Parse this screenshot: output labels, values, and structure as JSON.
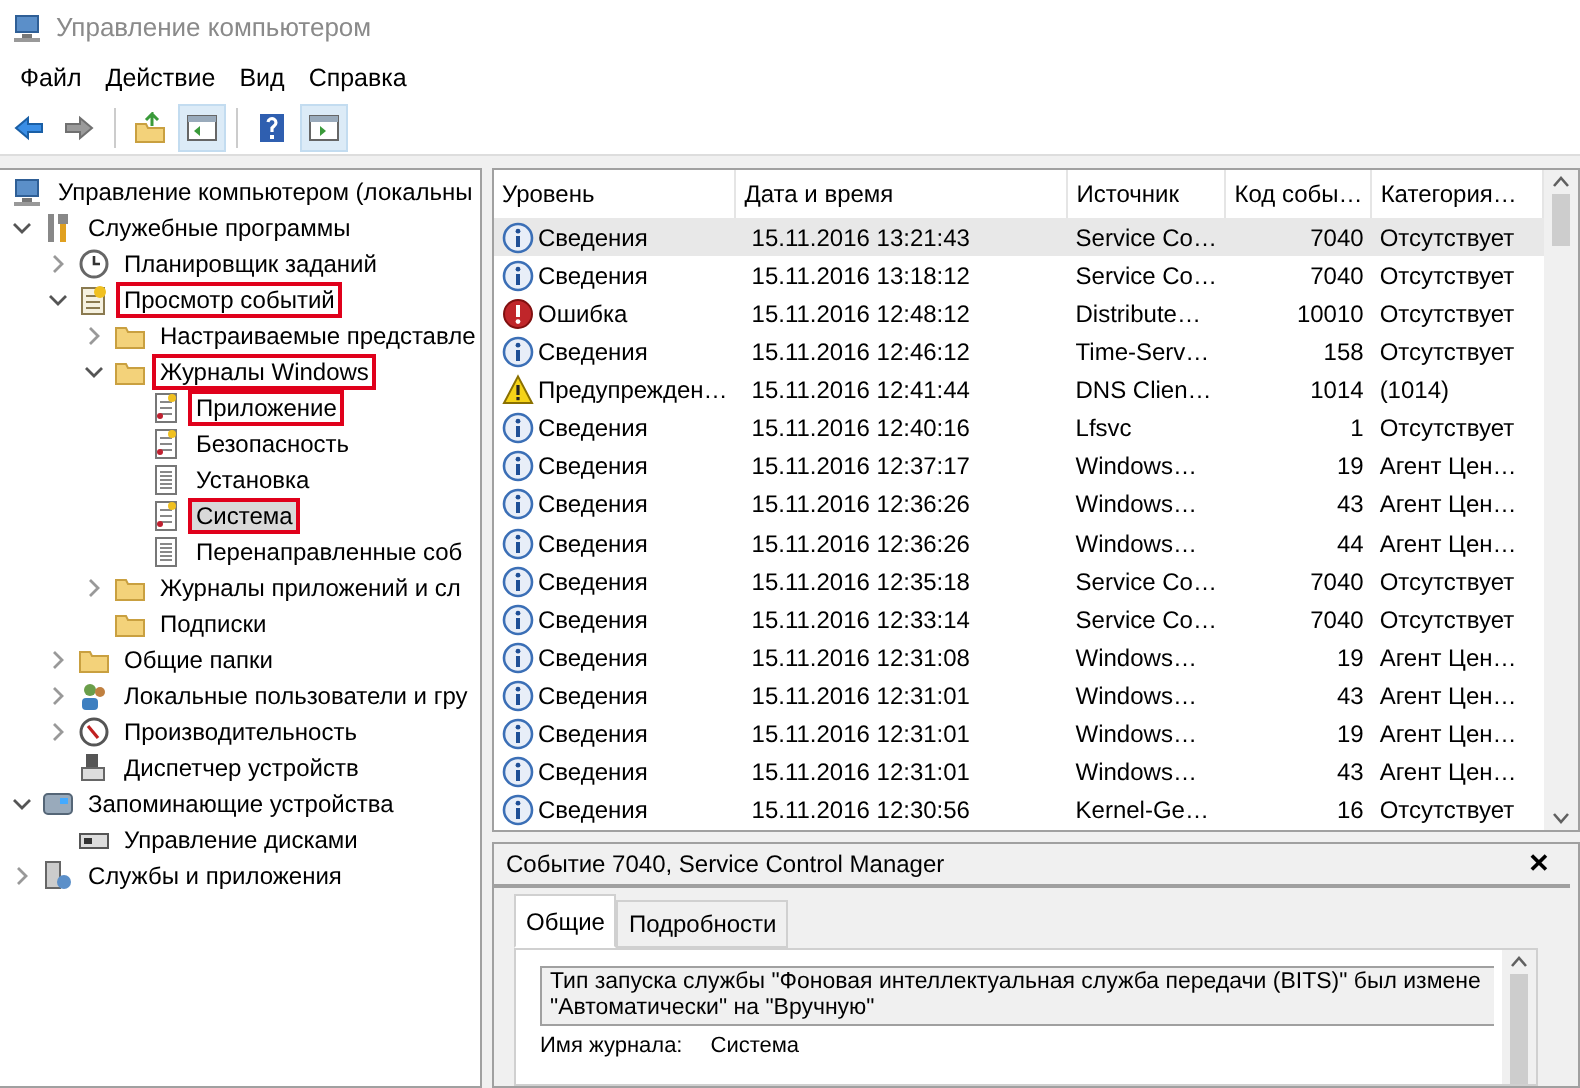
{
  "window": {
    "title": "Управление компьютером"
  },
  "menu": [
    "Файл",
    "Действие",
    "Вид",
    "Справка"
  ],
  "toolbar": [
    {
      "pressed": false
    },
    {
      "pressed": false
    },
    {
      "pressed": false
    },
    {
      "pressed": true
    },
    {
      "pressed": false
    },
    {
      "pressed": true
    }
  ],
  "tree": [
    {
      "label": "Управление компьютером (локальны",
      "selected": false,
      "highlighted": false,
      "children": [
        {
          "label": "Служебные программы",
          "selected": false,
          "highlighted": false,
          "expanded": true,
          "children": [
            {
              "label": "Планировщик заданий",
              "selected": false,
              "highlighted": false,
              "expanded": false
            },
            {
              "label": "Просмотр событий",
              "selected": false,
              "highlighted": true,
              "expanded": true,
              "children": [
                {
                  "label": "Настраиваемые представле",
                  "selected": false,
                  "highlighted": false,
                  "expanded": false
                },
                {
                  "label": "Журналы Windows",
                  "selected": false,
                  "highlighted": true,
                  "expanded": true,
                  "children": [
                    {
                      "label": "Приложение",
                      "selected": false,
                      "highlighted": true
                    },
                    {
                      "label": "Безопасность",
                      "selected": false,
                      "highlighted": false
                    },
                    {
                      "label": "Установка",
                      "selected": false,
                      "highlighted": false
                    },
                    {
                      "label": "Система",
                      "selected": true,
                      "highlighted": true
                    },
                    {
                      "label": "Перенаправленные соб",
                      "selected": false,
                      "highlighted": false
                    }
                  ]
                },
                {
                  "label": "Журналы приложений и сл",
                  "selected": false,
                  "highlighted": false,
                  "expanded": false
                },
                {
                  "label": "Подписки",
                  "selected": false,
                  "highlighted": false
                }
              ]
            },
            {
              "label": "Общие папки",
              "selected": false,
              "highlighted": false,
              "expanded": false
            },
            {
              "label": "Локальные пользователи и гру",
              "selected": false,
              "highlighted": false,
              "expanded": false
            },
            {
              "label": "Производительность",
              "selected": false,
              "highlighted": false,
              "expanded": false
            },
            {
              "label": "Диспетчер устройств",
              "selected": false,
              "highlighted": false
            }
          ]
        },
        {
          "label": "Запоминающие устройства",
          "selected": false,
          "highlighted": false,
          "expanded": true,
          "children": [
            {
              "label": "Управление дисками",
              "selected": false,
              "highlighted": false
            }
          ]
        },
        {
          "label": "Службы и приложения",
          "selected": false,
          "highlighted": false,
          "expanded": false
        }
      ]
    }
  ],
  "table": {
    "columns": [
      "Уровень",
      "Дата и время",
      "Источник",
      "Код собы…",
      "Категория…"
    ],
    "rows": [
      {
        "kind": "info",
        "selected": true,
        "cells": [
          "Сведения",
          "15.11.2016 13:21:43",
          "Service Co…",
          "7040",
          "Отсутствует"
        ]
      },
      {
        "kind": "info",
        "selected": false,
        "cells": [
          "Сведения",
          "15.11.2016 13:18:12",
          "Service Co…",
          "7040",
          "Отсутствует"
        ]
      },
      {
        "kind": "error",
        "selected": false,
        "cells": [
          "Ошибка",
          "15.11.2016 12:48:12",
          "Distribute…",
          "10010",
          "Отсутствует"
        ]
      },
      {
        "kind": "info",
        "selected": false,
        "cells": [
          "Сведения",
          "15.11.2016 12:46:12",
          "Time-Serv…",
          "158",
          "Отсутствует"
        ]
      },
      {
        "kind": "warning",
        "selected": false,
        "cells": [
          "Предупрежден…",
          "15.11.2016 12:41:44",
          "DNS Clien…",
          "1014",
          "(1014)"
        ]
      },
      {
        "kind": "info",
        "selected": false,
        "cells": [
          "Сведения",
          "15.11.2016 12:40:16",
          "Lfsvc",
          "1",
          "Отсутствует"
        ]
      },
      {
        "kind": "info",
        "selected": false,
        "cells": [
          "Сведения",
          "15.11.2016 12:37:17",
          "Windows…",
          "19",
          "Агент Цен…"
        ]
      },
      {
        "kind": "info",
        "selected": false,
        "cells": [
          "Сведения",
          "15.11.2016 12:36:26",
          "Windows…",
          "43",
          "Агент Цен…"
        ]
      },
      {
        "kind": "info",
        "selected": false,
        "cells": [
          "Сведения",
          "15.11.2016 12:36:26",
          "Windows…",
          "44",
          "Агент Цен…"
        ]
      },
      {
        "kind": "info",
        "selected": false,
        "cells": [
          "Сведения",
          "15.11.2016 12:35:18",
          "Service Co…",
          "7040",
          "Отсутствует"
        ]
      },
      {
        "kind": "info",
        "selected": false,
        "cells": [
          "Сведения",
          "15.11.2016 12:33:14",
          "Service Co…",
          "7040",
          "Отсутствует"
        ]
      },
      {
        "kind": "info",
        "selected": false,
        "cells": [
          "Сведения",
          "15.11.2016 12:31:08",
          "Windows…",
          "19",
          "Агент Цен…"
        ]
      },
      {
        "kind": "info",
        "selected": false,
        "cells": [
          "Сведения",
          "15.11.2016 12:31:01",
          "Windows…",
          "43",
          "Агент Цен…"
        ]
      },
      {
        "kind": "info",
        "selected": false,
        "cells": [
          "Сведения",
          "15.11.2016 12:31:01",
          "Windows…",
          "19",
          "Агент Цен…"
        ]
      },
      {
        "kind": "info",
        "selected": false,
        "cells": [
          "Сведения",
          "15.11.2016 12:31:01",
          "Windows…",
          "43",
          "Агент Цен…"
        ]
      },
      {
        "kind": "info",
        "selected": false,
        "cells": [
          "Сведения",
          "15.11.2016 12:30:56",
          "Kernel-Ge…",
          "16",
          "Отсутствует"
        ]
      }
    ]
  },
  "detail": {
    "title": "Событие 7040, Service Control Manager",
    "close": "✕",
    "tabs": [
      {
        "label": "Общие",
        "selected": true
      },
      {
        "label": "Подробности",
        "selected": false
      }
    ],
    "description": [
      "Тип запуска службы \"Фоновая интеллектуальная служба передачи (BITS)\" был измене",
      "\"Автоматически\" на \"Вручную\""
    ],
    "log_name_label": "Имя журнала:",
    "log_name": "Система"
  }
}
